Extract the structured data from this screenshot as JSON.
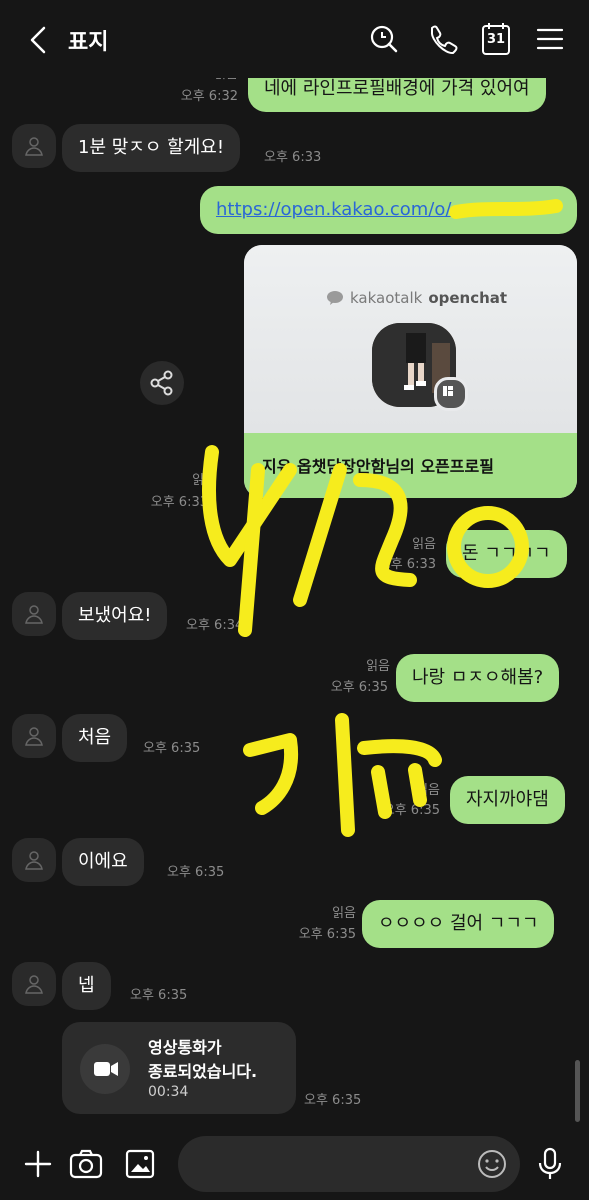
{
  "header": {
    "title": "표지",
    "calendar_day": "31"
  },
  "messages": {
    "m1": {
      "text": "네에 라인프로필배경에 가격 있어여",
      "read": "읽음",
      "time": "오후 6:32"
    },
    "m2": {
      "text": "1분 맞ㅈㅇ 할게요!",
      "time": "오후 6:33"
    },
    "m3": {
      "text": "https://open.kakao.com/o/"
    },
    "card": {
      "brand_prefix": "kakaotalk",
      "brand_suffix": "openchat",
      "title": "지유 옵챗담장안함님의 오픈프로필",
      "read": "읽음",
      "time": "오후 6:33"
    },
    "m4": {
      "text": "돈 ㄱㄱㄱㄱ",
      "read": "읽음",
      "time": "오후 6:33"
    },
    "m5": {
      "text": "보냈어요!",
      "time": "오후 6:34"
    },
    "m6": {
      "text": "나랑 ㅁㅈㅇ해봄?",
      "read": "읽음",
      "time": "오후 6:35"
    },
    "m7": {
      "text": "처음",
      "time": "오후 6:35"
    },
    "m8": {
      "text": "자지까야댐",
      "read": "읽음",
      "time": "오후 6:35"
    },
    "m9": {
      "text": "이에요",
      "time": "오후 6:35"
    },
    "m10": {
      "text": "ㅇㅇㅇㅇ 걸어 ㄱㄱㄱ",
      "read": "읽음",
      "time": "오후 6:35"
    },
    "m11": {
      "text": "넵",
      "time": "오후 6:35"
    },
    "call": {
      "line1": "영상통화가",
      "line2": "종료되었습니다.",
      "duration": "00:34",
      "time": "오후 6:35"
    }
  },
  "colors": {
    "background": "#161616",
    "my_bubble": "#a4e088",
    "other_bubble": "#2c2c2c",
    "link": "#2a67d6",
    "scribble": "#f6ec1d"
  },
  "icons": [
    "back-arrow-icon",
    "search-icon",
    "phone-icon",
    "calendar-icon",
    "menu-icon",
    "share-icon",
    "video-call-icon",
    "plus-icon",
    "camera-icon",
    "gallery-icon",
    "emoji-icon",
    "microphone-icon",
    "profile-placeholder-icon"
  ]
}
